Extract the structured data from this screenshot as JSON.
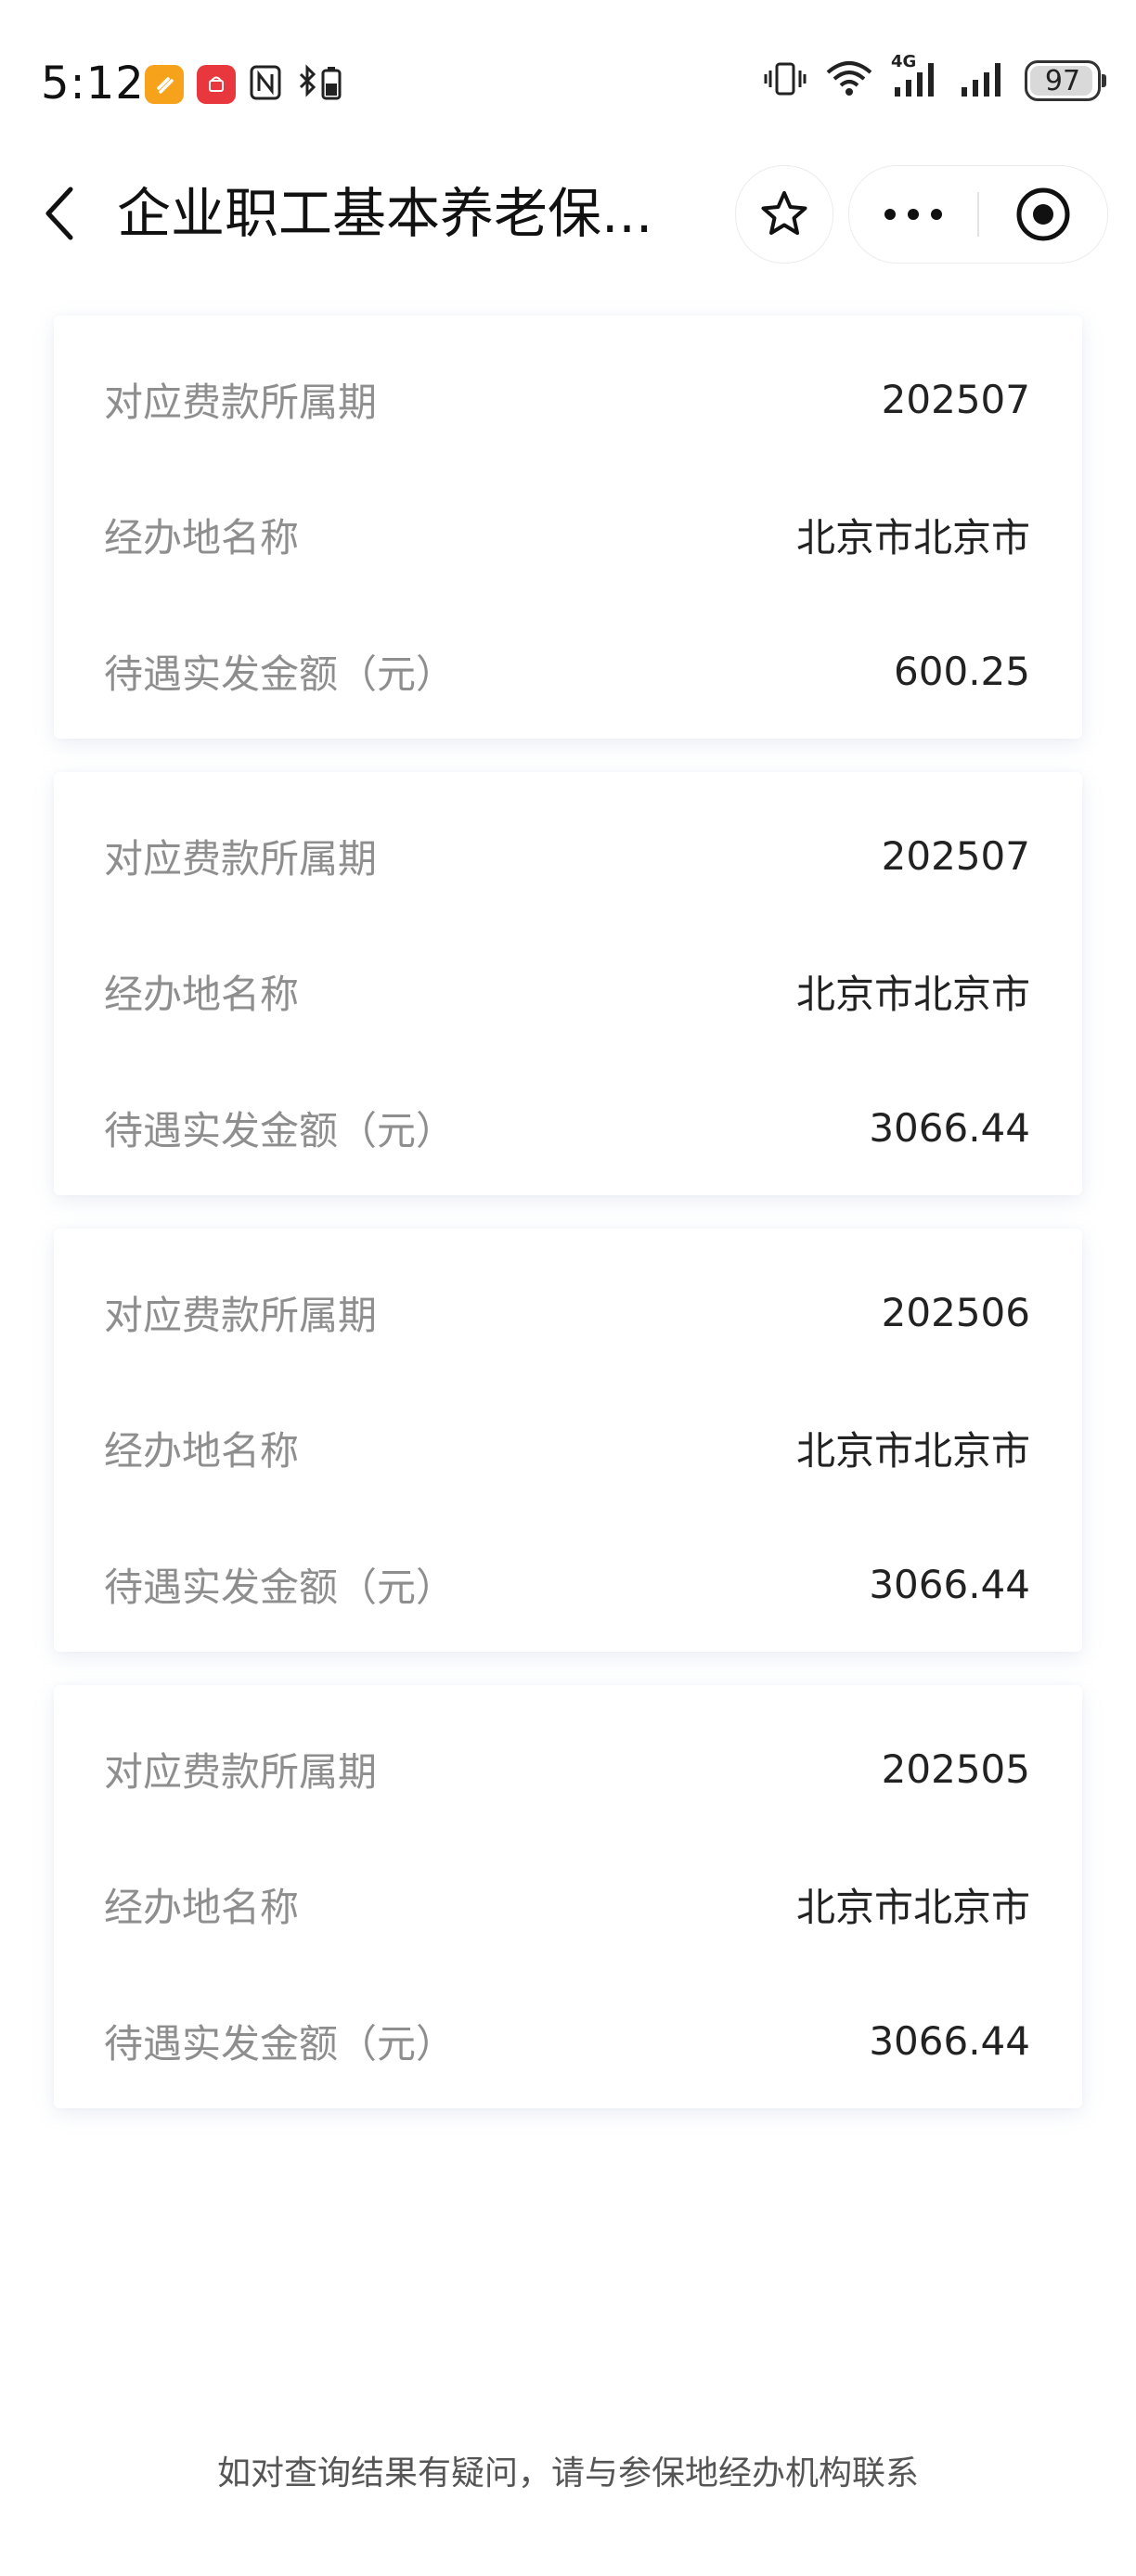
{
  "status_bar": {
    "time": "5:12",
    "battery": "97",
    "network": "4G"
  },
  "nav": {
    "title": "企业职工基本养老保..."
  },
  "records": [
    {
      "period_label": "对应费款所属期",
      "period": "202507",
      "place_label": "经办地名称",
      "place": "北京市北京市",
      "amount_label": "待遇实发金额（元）",
      "amount": "600.25"
    },
    {
      "period_label": "对应费款所属期",
      "period": "202507",
      "place_label": "经办地名称",
      "place": "北京市北京市",
      "amount_label": "待遇实发金额（元）",
      "amount": "3066.44"
    },
    {
      "period_label": "对应费款所属期",
      "period": "202506",
      "place_label": "经办地名称",
      "place": "北京市北京市",
      "amount_label": "待遇实发金额（元）",
      "amount": "3066.44"
    },
    {
      "period_label": "对应费款所属期",
      "period": "202505",
      "place_label": "经办地名称",
      "place": "北京市北京市",
      "amount_label": "待遇实发金额（元）",
      "amount": "3066.44"
    }
  ],
  "footer": {
    "note": "如对查询结果有疑问，请与参保地经办机构联系"
  }
}
